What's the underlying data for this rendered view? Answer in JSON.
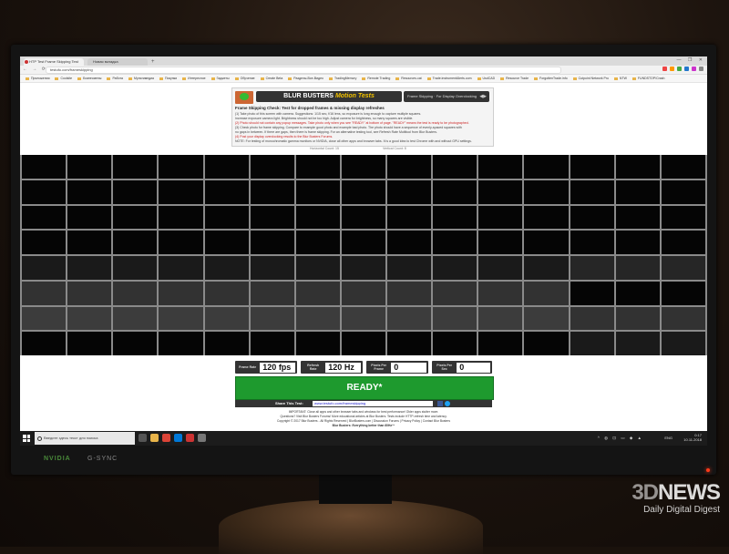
{
  "browser": {
    "tab_active": "HTP Test Frame Skipping Test",
    "tab_inactive": "Новая вкладка",
    "new_tab": "+",
    "window_controls": "— ❐ ✕",
    "nav_icons": "← → ⟳",
    "url": "testufo.com/frameskipping",
    "bookmarks": [
      "Приложения",
      "Coolsite",
      "Бизнесмены",
      "Работа",
      "Мультимедиа",
      "Покупки",
      "Интересное",
      "Гаджеты",
      "Обучение",
      "Create Beta",
      "Разделы-Все-Видео",
      "TradingMemory",
      "Remote Trading",
      "Resources.cat",
      "Trade.instrumentAlerts.com",
      "UsdCAD",
      "Resource Trade",
      "ForgottenTrade.info",
      "Cutpoint Network Pro",
      "NTW",
      "FUNDSTOP/Crash"
    ]
  },
  "site": {
    "brand": "BLUR BUSTERS",
    "brand_tag": "Motion Tests",
    "test_select": "Frame Skipping · For Display Overclocking",
    "info_title": "Frame Skipping Check: Test for dropped frames & missing display refreshes",
    "info_lines": [
      "(1) Take photo of this screen with camera. Suggestions: 1/15 sec, f/16 lens, so exposure is long enough to capture multiple squares.",
      "Increase exposure camera light. Brightness should not be too high. Adjust camera for brightness, so many squares are visible.",
      "(2) Photo should not contain any popup messages. Take photo only when you see \"READY\" at bottom of page. \"READY\" means the test is ready to be photographed.",
      "(3) Check photo for frame skipping. Compare to example good photo and example bad photo. The photo should have a sequence of evenly-spaced squares with",
      "no gaps in between. If there are gaps, then there is frame skipping. For an alternative testing tool, see Refresh Rate Multitool from Blur Busters.",
      "(4) Post your display overclocking results to the Blur Busters Forums.",
      "NOTE: For testing of monochromatic gamma monitors or NVIDIA, close all other apps and browser tabs. It is a good idea to test Chrome with and without GPU settings."
    ],
    "subcaption_left": "Horizontal Count: 15",
    "subcaption_right": "Vertical Count: 8"
  },
  "readouts": [
    {
      "label": "Frame Rate",
      "value": "120 fps"
    },
    {
      "label": "Refresh Rate",
      "value": "120 Hz"
    },
    {
      "label": "Pixels Per Frame",
      "value": "0"
    },
    {
      "label": "Pixels Per Sec",
      "value": "0"
    }
  ],
  "ready_label": "READY*",
  "share": {
    "label": "Share This Test:",
    "url": "www.testufo.com/frameskipping"
  },
  "footer_lines": [
    "IMPORTANT: Close all apps and other browser tabs and windows for best performance! Older apps stutter more.",
    "Questions? Visit Blur Busters Forums! More educational articles at Blur Busters. Tests include HTTP-refresh time and latency.",
    "Copyright © 2017 Blur Busters - All Rights Reserved | BlurBusters.com | Discussion Forums | Privacy Policy | Contact Blur Busters",
    "Blur Busters: Everything better than 60Hz™"
  ],
  "taskbar": {
    "search_placeholder": "Введите здесь текст для поиска",
    "language": "ENG",
    "time": "0:17",
    "date": "10.11.2018",
    "tray_icons": "^ ◍ ⊡ ▭ ◆ ▲"
  },
  "monitor_brand": "NVIDIA",
  "monitor_gsync": "G-SYNC",
  "watermark": {
    "big_a": "3D",
    "big_b": "NEWS",
    "small": "Daily Digital Digest"
  },
  "grid": {
    "columns": 15,
    "rows": 8,
    "shades": [
      "000000000000000",
      "000000000000000",
      "000000000000000",
      "000000000000000",
      "111111111111222",
      "333333333333000",
      "444444444444333",
      "000000000000111"
    ]
  }
}
